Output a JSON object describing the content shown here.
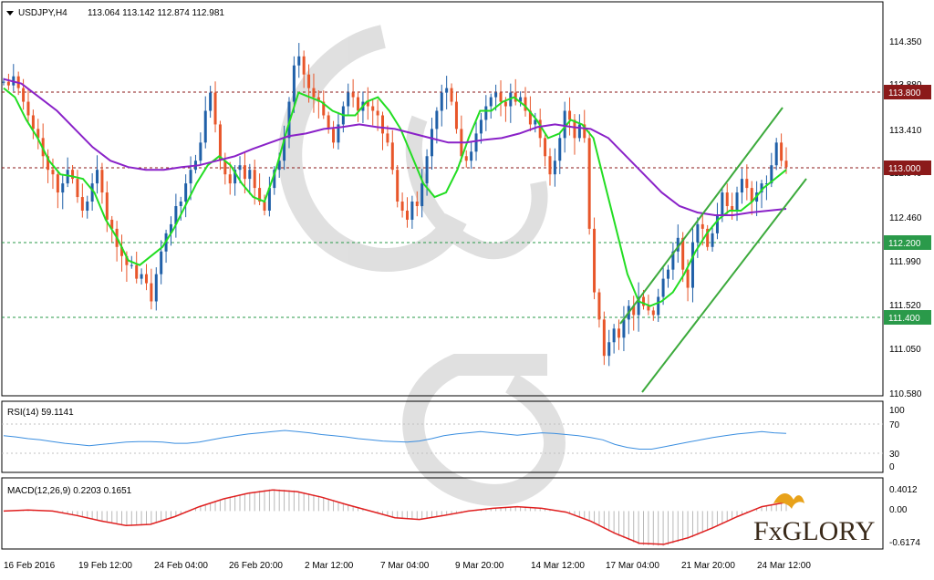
{
  "header": {
    "title": "USDJPY,H4",
    "ohlc": "113.064 113.142 112.874 112.981"
  },
  "colors": {
    "bull_candle": "#2060a8",
    "bear_candle": "#e8562a",
    "ma_fast": "#22dd22",
    "ma_slow": "#8a22c8",
    "resistance_line": "#8b1a1a",
    "support_line": "#2a9a4a",
    "channel_line": "#3caa3c",
    "rsi_line": "#3a8ee0",
    "macd_signal": "#e02020",
    "macd_hist": "#b8b8b8",
    "brand_gold": "#d18a1a",
    "brand_dark": "#3a2a1a"
  },
  "price_panel": {
    "y_ticks": [
      "114.350",
      "113.880",
      "113.410",
      "112.940",
      "112.460",
      "111.990",
      "111.520",
      "111.050",
      "110.580"
    ],
    "levels": [
      {
        "value": 113.8,
        "label": "113.800",
        "kind": "resistance"
      },
      {
        "value": 113.0,
        "label": "113.000",
        "kind": "resistance"
      },
      {
        "value": 112.2,
        "label": "112.200",
        "kind": "support"
      },
      {
        "value": 111.4,
        "label": "111.400",
        "kind": "support"
      }
    ]
  },
  "rsi_panel": {
    "label": "RSI(14) 59.1141",
    "y_ticks": [
      "100",
      "70",
      "30",
      "0"
    ]
  },
  "macd_panel": {
    "label": "MACD(12,26,9) 0.2203 0.1651",
    "y_ticks": [
      "0.4012",
      "0.00",
      "-0.6174"
    ]
  },
  "x_ticks": [
    "16 Feb 2016",
    "19 Feb 12:00",
    "24 Feb 04:00",
    "26 Feb 20:00",
    "2 Mar 12:00",
    "7 Mar 04:00",
    "9 Mar 20:00",
    "14 Mar 12:00",
    "17 Mar 04:00",
    "21 Mar 20:00",
    "24 Mar 12:00"
  ],
  "brand": {
    "logo": "FxGLORY"
  },
  "chart_data": {
    "type": "candlestick",
    "title": "USDJPY,H4",
    "ylim": [
      110.48,
      114.62
    ],
    "close_approx": [
      113.92,
      113.88,
      113.98,
      113.85,
      113.7,
      113.55,
      113.4,
      113.3,
      113.1,
      112.95,
      112.9,
      112.7,
      112.8,
      112.95,
      112.85,
      112.65,
      112.5,
      112.6,
      112.8,
      112.95,
      112.7,
      112.4,
      112.3,
      112.1,
      112.0,
      111.9,
      111.9,
      111.75,
      111.8,
      111.7,
      111.5,
      111.8,
      112.05,
      112.25,
      112.35,
      112.55,
      112.6,
      112.8,
      112.95,
      113.05,
      113.25,
      113.6,
      113.8,
      113.45,
      113.05,
      112.9,
      112.8,
      112.95,
      113.0,
      112.85,
      112.95,
      112.75,
      112.6,
      112.5,
      112.75,
      112.95,
      113.05,
      113.3,
      113.7,
      114.1,
      114.2,
      114.0,
      113.85,
      113.75,
      113.7,
      113.55,
      113.4,
      113.25,
      113.45,
      113.65,
      113.8,
      113.75,
      113.6,
      113.7,
      113.65,
      113.6,
      113.55,
      113.35,
      113.25,
      112.95,
      112.6,
      112.5,
      112.4,
      112.6,
      112.55,
      112.8,
      113.1,
      113.4,
      113.6,
      113.8,
      113.85,
      113.7,
      113.4,
      113.1,
      113.05,
      113.15,
      113.35,
      113.5,
      113.65,
      113.75,
      113.8,
      113.7,
      113.65,
      113.8,
      113.7,
      113.75,
      113.6,
      113.45,
      113.5,
      113.3,
      113.1,
      112.9,
      113.05,
      113.3,
      113.6,
      113.5,
      113.3,
      113.45,
      113.3,
      112.3,
      111.6,
      111.3,
      110.9,
      111.05,
      111.2,
      111.1,
      111.3,
      111.45,
      111.35,
      111.55,
      111.45,
      111.4,
      111.35,
      111.55,
      111.75,
      111.85,
      112.05,
      112.2,
      111.85,
      111.65,
      112.15,
      112.35,
      112.3,
      112.1,
      112.25,
      112.45,
      112.7,
      112.55,
      112.5,
      112.7,
      112.85,
      112.75,
      112.6,
      112.7,
      112.8,
      112.8,
      113.0,
      113.25,
      113.05,
      112.98
    ],
    "series": [
      {
        "name": "MA fast",
        "values": [
          113.85,
          113.75,
          113.5,
          113.3,
          113.05,
          112.9,
          112.88,
          112.85,
          112.7,
          112.4,
          112.2,
          111.95,
          111.9,
          112.0,
          112.1,
          112.3,
          112.55,
          112.8,
          113.0,
          113.1,
          113.0,
          112.8,
          112.65,
          112.6,
          112.95,
          113.4,
          113.8,
          113.75,
          113.7,
          113.6,
          113.55,
          113.55,
          113.7,
          113.75,
          113.6,
          113.4,
          113.1,
          112.8,
          112.65,
          112.7,
          112.95,
          113.3,
          113.6,
          113.6,
          113.7,
          113.75,
          113.65,
          113.5,
          113.3,
          113.35,
          113.5,
          113.45,
          113.3,
          112.8,
          112.3,
          111.8,
          111.5,
          111.45,
          111.5,
          111.6,
          111.8,
          112.05,
          112.25,
          112.4,
          112.5,
          112.5,
          112.6,
          112.75,
          112.85,
          112.95
        ]
      },
      {
        "name": "MA slow",
        "values": [
          113.95,
          113.9,
          113.75,
          113.6,
          113.4,
          113.2,
          113.05,
          112.98,
          112.95,
          112.95,
          112.98,
          113.0,
          113.05,
          113.1,
          113.18,
          113.25,
          113.32,
          113.35,
          113.4,
          113.42,
          113.45,
          113.42,
          113.4,
          113.35,
          113.3,
          113.25,
          113.25,
          113.28,
          113.3,
          113.35,
          113.42,
          113.45,
          113.42,
          113.4,
          113.3,
          113.1,
          112.9,
          112.7,
          112.55,
          112.48,
          112.45,
          112.45,
          112.48,
          112.5,
          112.52
        ]
      },
      {
        "name": "RSI(14)",
        "values": [
          55,
          53,
          50,
          48,
          45,
          42,
          40,
          38,
          40,
          42,
          44,
          45,
          45,
          44,
          42,
          42,
          44,
          48,
          52,
          55,
          58,
          60,
          62,
          64,
          62,
          60,
          57,
          55,
          53,
          50,
          48,
          46,
          45,
          44,
          46,
          50,
          55,
          58,
          60,
          62,
          60,
          58,
          56,
          58,
          60,
          59,
          57,
          55,
          52,
          48,
          40,
          35,
          32,
          32,
          36,
          40,
          44,
          48,
          52,
          55,
          58,
          60,
          62,
          60,
          59
        ]
      },
      {
        "name": "MACD(12,26,9) signal",
        "values": [
          0.0,
          0.02,
          0.0,
          -0.08,
          -0.18,
          -0.26,
          -0.24,
          -0.1,
          0.08,
          0.22,
          0.32,
          0.38,
          0.35,
          0.25,
          0.12,
          0.0,
          -0.12,
          -0.15,
          -0.08,
          0.0,
          0.05,
          0.08,
          0.05,
          -0.02,
          -0.18,
          -0.4,
          -0.58,
          -0.6,
          -0.48,
          -0.3,
          -0.1,
          0.08,
          0.16
        ]
      }
    ],
    "rsi": {
      "upper": 70,
      "lower": 30,
      "last": 59.1141
    },
    "macd": {
      "main": 0.2203,
      "signal": 0.1651,
      "ylim": [
        -0.6174,
        0.4012
      ]
    }
  }
}
